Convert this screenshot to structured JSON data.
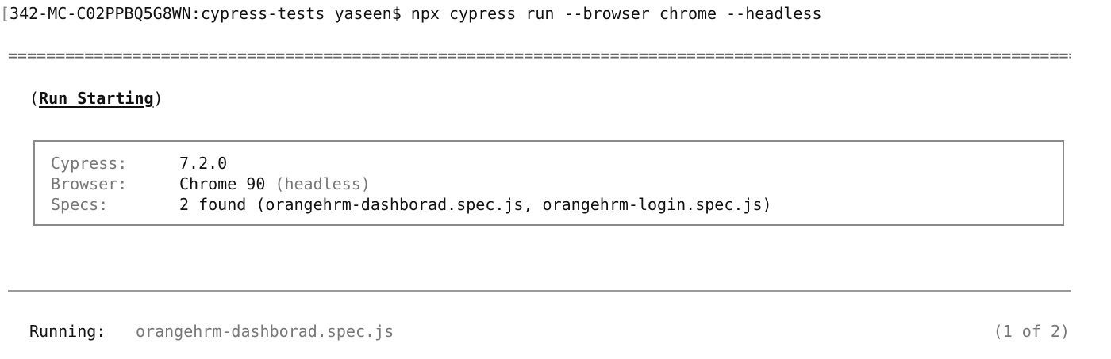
{
  "terminal": {
    "prompt_bracket": "[",
    "prompt": "342-MC-C02PPBQ5G8WN:cypress-tests yaseen$",
    "command": "npx cypress run --browser chrome --headless",
    "separator": "======================================================================================================================="
  },
  "run_starting": {
    "open_paren": "(",
    "title": "Run Starting",
    "close_paren": ")"
  },
  "info": {
    "cypress_label": "Cypress:",
    "cypress_value": "7.2.0",
    "browser_label": "Browser:",
    "browser_value": "Chrome 90",
    "browser_mode": "(headless)",
    "specs_label": "Specs:",
    "specs_value": "2 found (orangehrm-dashborad.spec.js, orangehrm-login.spec.js)"
  },
  "running": {
    "label": "Running:",
    "spec": "orangehrm-dashborad.spec.js",
    "count": "(1 of 2)"
  },
  "colors": {
    "text": "#111111",
    "dim": "#777777",
    "border": "#8a8a8a"
  }
}
